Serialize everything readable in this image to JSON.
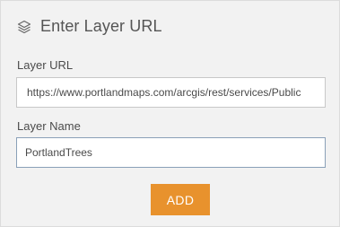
{
  "header": {
    "icon": "layers-icon",
    "title": "Enter Layer URL"
  },
  "form": {
    "url_label": "Layer URL",
    "url_value": "https://www.portlandmaps.com/arcgis/rest/services/Public",
    "name_label": "Layer Name",
    "name_value": "PortlandTrees",
    "add_label": "ADD"
  },
  "colors": {
    "panel_bg": "#f2f2f2",
    "button_bg": "#e8922d",
    "focused_border": "#8aa0b8"
  }
}
